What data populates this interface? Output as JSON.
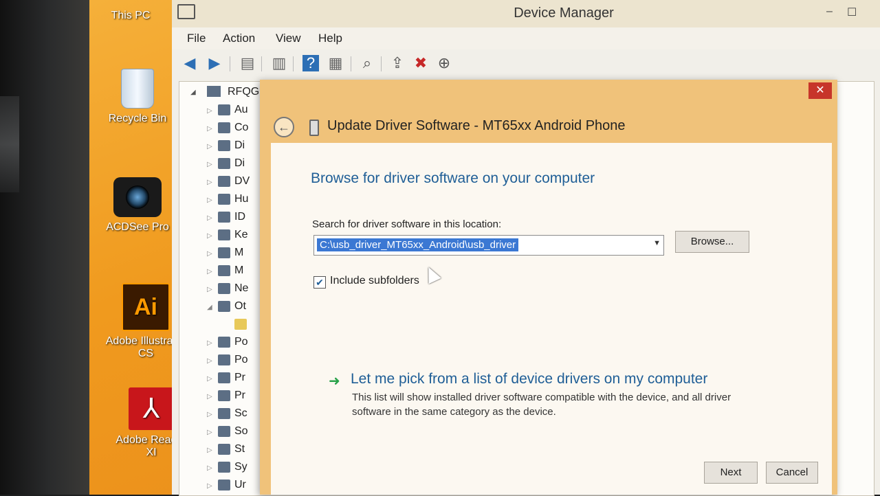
{
  "desktop": {
    "icons": [
      {
        "label": "This PC"
      },
      {
        "label": "Recycle Bin"
      },
      {
        "label": "ACDSee Pro"
      },
      {
        "label": "Adobe Illustrator CS",
        "glyph": "Ai"
      },
      {
        "label": "Adobe Reader XI",
        "glyph": "⅄"
      }
    ]
  },
  "device_manager": {
    "title": "Device Manager",
    "window_controls": {
      "minimize": "–",
      "maximize": "☐"
    },
    "menu": [
      "File",
      "Action",
      "View",
      "Help"
    ],
    "toolbar_icons": [
      "back-arrow-icon",
      "forward-arrow-icon",
      "properties-icon",
      "show-hidden-icon",
      "help-icon",
      "console-tree-icon",
      "scan-hardware-icon",
      "update-driver-icon",
      "uninstall-icon",
      "enable-device-icon"
    ],
    "tree": {
      "root": "RFQG",
      "items": [
        "Au",
        "Co",
        "Di",
        "Di",
        "DV",
        "Hu",
        "ID",
        "Ke",
        "M",
        "M",
        "Ne",
        "Ot",
        "Po",
        "Po",
        "Pr",
        "Pr",
        "Sc",
        "So",
        "St",
        "Sy",
        "Ur"
      ]
    }
  },
  "dialog": {
    "close": "✕",
    "back_glyph": "←",
    "title": "Update Driver Software - MT65xx Android Phone",
    "heading": "Browse for driver software on your computer",
    "location_label": "Search for driver software in this location:",
    "location_value": "C:\\usb_driver_MT65xx_Android\\usb_driver",
    "browse_label": "Browse...",
    "include_subfolders_label": "Include subfolders",
    "include_subfolders_checked": true,
    "pick_arrow": "➜",
    "pick_title": "Let me pick from a list of device drivers on my computer",
    "pick_description": "This list will show installed driver software compatible with the device, and all driver software in the same category as the device.",
    "next_label": "Next",
    "cancel_label": "Cancel"
  }
}
